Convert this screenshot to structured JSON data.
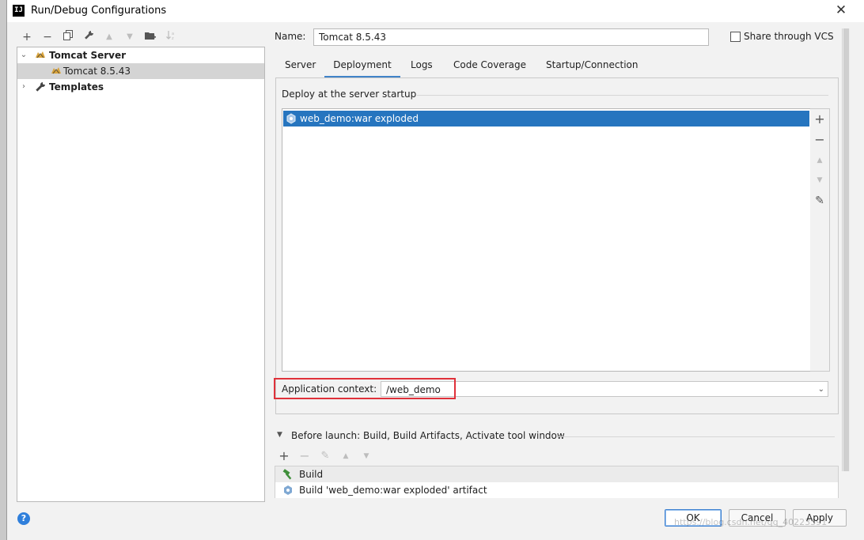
{
  "window": {
    "title": "Run/Debug Configurations",
    "icon_text": "IJ"
  },
  "toolbar": {
    "add": "+",
    "remove": "−",
    "copy": "⧉",
    "edit": "🔧",
    "move_up": "▲",
    "move_down": "▼",
    "folder": "📁",
    "sort": "↓"
  },
  "tree": {
    "items": [
      {
        "label": "Tomcat Server",
        "icon": "tomcat-icon",
        "expanded": true
      },
      {
        "label": "Tomcat 8.5.43",
        "icon": "tomcat-icon",
        "selected": true
      },
      {
        "label": "Templates",
        "icon": "wrench-icon",
        "expanded": false
      }
    ]
  },
  "form": {
    "name_label": "Name:",
    "name_value": "Tomcat 8.5.43",
    "share_vcs_label": "Share through VCS"
  },
  "tabs": [
    {
      "label": "Server"
    },
    {
      "label": "Deployment",
      "active": true
    },
    {
      "label": "Logs"
    },
    {
      "label": "Code Coverage"
    },
    {
      "label": "Startup/Connection"
    }
  ],
  "deployment": {
    "title": "Deploy at the server startup",
    "items": [
      {
        "label": "web_demo:war exploded",
        "icon": "artifact-icon"
      }
    ],
    "side_buttons": {
      "add": "+",
      "remove": "−",
      "up": "▲",
      "down": "▼",
      "edit": "✎"
    },
    "app_context_label": "Application context:",
    "app_context_value": "/web_demo"
  },
  "before_launch": {
    "label": "Before launch: Build, Build Artifacts, Activate tool window",
    "toolbar": {
      "add": "+",
      "remove": "−",
      "edit": "✎",
      "up": "▲",
      "down": "▼"
    },
    "items": [
      {
        "label": "Build",
        "icon": "hammer-icon"
      },
      {
        "label": "Build 'web_demo:war exploded' artifact",
        "icon": "artifact-icon"
      }
    ]
  },
  "buttons": {
    "help": "?",
    "ok": "OK",
    "cancel": "Cancel",
    "apply": "Apply"
  },
  "watermark": "https://blog.csdn.net/qq_40223391",
  "colors": {
    "selection": "#2675bf",
    "accent": "#4083c9",
    "highlight_box": "#e0313a"
  }
}
